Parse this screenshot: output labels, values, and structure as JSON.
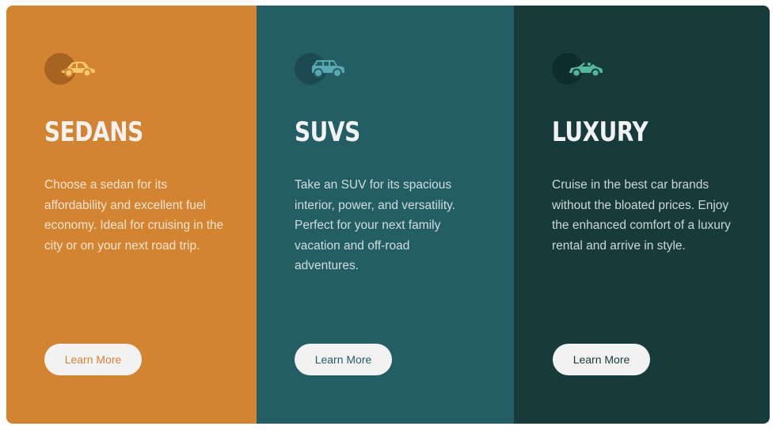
{
  "cards": [
    {
      "title": "SEDANS",
      "description": "Choose a sedan for its affordability and excellent fuel economy. Ideal for cruising in the city or on your next road trip.",
      "button_label": "Learn More",
      "icon": "sedan-car-icon",
      "background_color": "#d38431",
      "icon_color": "#f6c76c"
    },
    {
      "title": "SUVS",
      "description": "Take an SUV for its spacious interior, power, and versatility. Perfect for your next family vacation and off-road adventures.",
      "button_label": "Learn More",
      "icon": "suv-car-icon",
      "background_color": "#245e65",
      "icon_color": "#5aa8b4"
    },
    {
      "title": "LUXURY",
      "description": "Cruise in the best car brands without the bloated prices. Enjoy the enhanced comfort of a luxury rental and arrive in style.",
      "button_label": "Learn More",
      "icon": "convertible-car-icon",
      "background_color": "#173b3b",
      "icon_color": "#53b79b"
    }
  ]
}
